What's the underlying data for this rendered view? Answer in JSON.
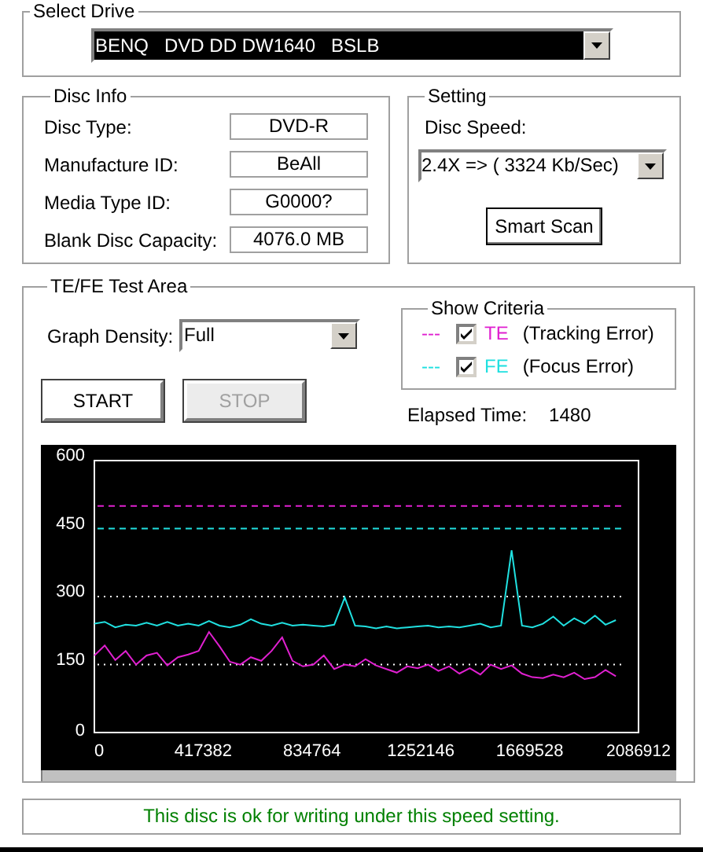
{
  "select_drive": {
    "title": "Select Drive",
    "value": "BENQ   DVD DD DW1640   BSLB"
  },
  "disc_info": {
    "title": "Disc Info",
    "fields": [
      {
        "label": "Disc Type:",
        "value": "DVD-R"
      },
      {
        "label": "Manufacture ID:",
        "value": "BeAll"
      },
      {
        "label": "Media Type ID:",
        "value": "G0000?"
      },
      {
        "label": "Blank Disc Capacity:",
        "value": "4076.0 MB"
      }
    ]
  },
  "setting": {
    "title": "Setting",
    "speed_label": "Disc Speed:",
    "speed_value": "2.4X => ( 3324 Kb/Sec)",
    "button": "Smart Scan"
  },
  "test_area": {
    "title": "TE/FE Test Area",
    "density_label": "Graph Density:",
    "density_value": "Full",
    "buttons": [
      {
        "label": "START",
        "disabled": false
      },
      {
        "label": "STOP",
        "disabled": true
      }
    ],
    "criteria": {
      "title": "Show Criteria",
      "items": [
        {
          "dash": "---",
          "desc": "(Tracking Error)",
          "color": "#e020d0",
          "checked": true
        },
        {
          "dash": "---",
          "desc": "(Focus Error)",
          "color": "#20e0e0",
          "checked": true
        }
      ]
    },
    "elapsed_label": "Elapsed Time:",
    "elapsed_value": "1480",
    "chart_data": {
      "type": "line",
      "x": [
        0,
        40000,
        80000,
        120000,
        160000,
        200000,
        240000,
        280000,
        320000,
        360000,
        400000,
        440000,
        480000,
        520000,
        560000,
        600000,
        640000,
        680000,
        720000,
        760000,
        800000,
        840000,
        880000,
        920000,
        960000,
        1000000,
        1040000,
        1080000,
        1120000,
        1160000,
        1200000,
        1240000,
        1280000,
        1320000,
        1360000,
        1400000,
        1440000,
        1480000,
        1520000,
        1560000,
        1600000,
        1640000,
        1680000,
        1720000,
        1760000,
        1800000,
        1840000,
        1880000,
        1920000,
        1960000,
        2000000
      ],
      "series": [
        {
          "name": "TE",
          "color": "#e020d0",
          "values": [
            170,
            192,
            160,
            180,
            150,
            170,
            176,
            148,
            166,
            172,
            180,
            222,
            190,
            156,
            150,
            166,
            158,
            180,
            210,
            158,
            146,
            150,
            170,
            140,
            150,
            146,
            162,
            148,
            140,
            132,
            146,
            142,
            150,
            136,
            146,
            130,
            142,
            128,
            150,
            140,
            148,
            130,
            122,
            120,
            128,
            122,
            132,
            118,
            122,
            138,
            124
          ]
        },
        {
          "name": "FE",
          "color": "#20e0e0",
          "values": [
            240,
            244,
            232,
            238,
            236,
            242,
            236,
            244,
            236,
            240,
            236,
            246,
            236,
            232,
            238,
            250,
            240,
            236,
            242,
            236,
            238,
            236,
            234,
            238,
            298,
            236,
            234,
            230,
            234,
            230,
            232,
            234,
            236,
            232,
            234,
            232,
            236,
            240,
            232,
            236,
            402,
            236,
            232,
            240,
            256,
            236,
            252,
            240,
            258,
            238,
            248
          ]
        }
      ],
      "xlim": [
        0,
        2086912
      ],
      "ylim": [
        0,
        600
      ],
      "xticks": [
        0,
        417382,
        834764,
        1252146,
        1669528,
        2086912
      ],
      "yticks": [
        0,
        150,
        300,
        450,
        600
      ],
      "ref_lines": [
        {
          "axis": "y",
          "value": 500,
          "color": "#e020d0"
        },
        {
          "axis": "y",
          "value": 450,
          "color": "#20e0e0"
        }
      ]
    }
  },
  "status": "This disc is ok for writing under this speed setting."
}
